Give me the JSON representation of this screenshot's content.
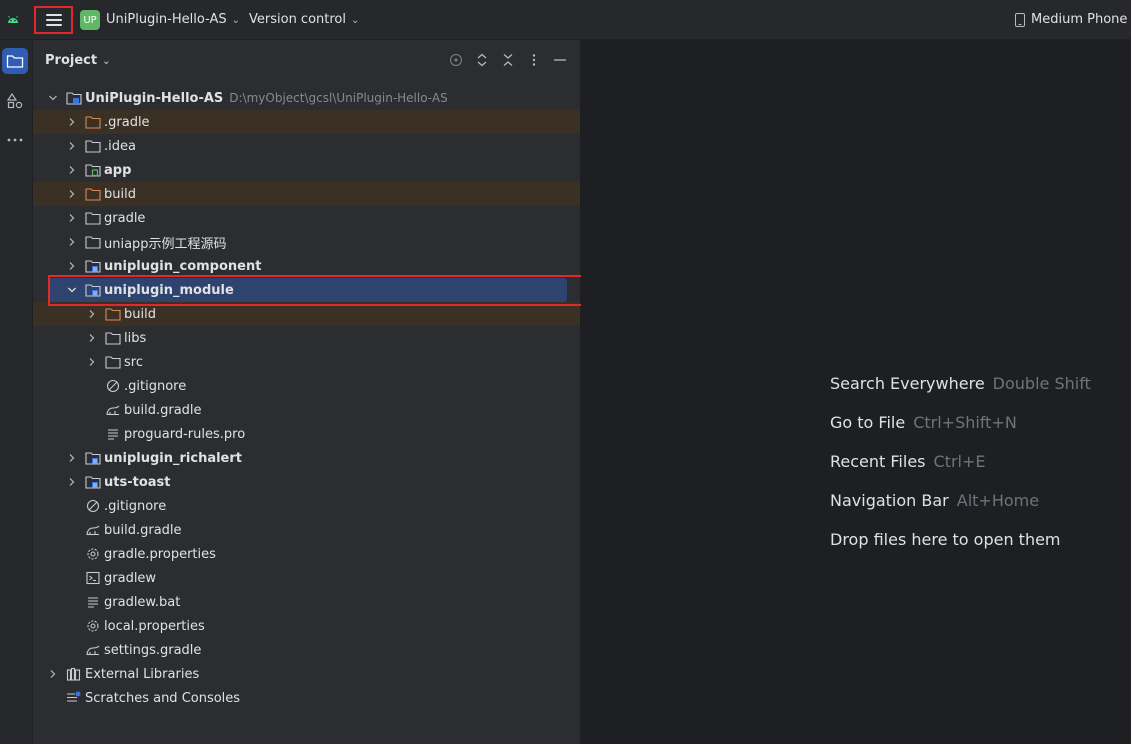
{
  "titlebar": {
    "project_badge": "UP",
    "project_name": "UniPlugin-Hello-AS",
    "vcs_label": "Version control",
    "device_label": "Medium Phone A"
  },
  "panel": {
    "title": "Project"
  },
  "tree": {
    "root": {
      "label": "UniPlugin-Hello-AS",
      "path": "D:\\myObject\\gcsl\\UniPlugin-Hello-AS"
    },
    "items": [
      {
        "label": ".gradle"
      },
      {
        "label": ".idea"
      },
      {
        "label": "app"
      },
      {
        "label": "build"
      },
      {
        "label": "gradle"
      },
      {
        "label": "uniapp示例工程源码"
      },
      {
        "label": "uniplugin_component"
      },
      {
        "label": "uniplugin_module"
      },
      {
        "label": "build"
      },
      {
        "label": "libs"
      },
      {
        "label": "src"
      },
      {
        "label": ".gitignore"
      },
      {
        "label": "build.gradle"
      },
      {
        "label": "proguard-rules.pro"
      },
      {
        "label": "uniplugin_richalert"
      },
      {
        "label": "uts-toast"
      },
      {
        "label": ".gitignore"
      },
      {
        "label": "build.gradle"
      },
      {
        "label": "gradle.properties"
      },
      {
        "label": "gradlew"
      },
      {
        "label": "gradlew.bat"
      },
      {
        "label": "local.properties"
      },
      {
        "label": "settings.gradle"
      },
      {
        "label": "External Libraries"
      },
      {
        "label": "Scratches and Consoles"
      }
    ]
  },
  "editor": {
    "hints": [
      {
        "action": "Search Everywhere",
        "key": "Double Shift"
      },
      {
        "action": "Go to File",
        "key": "Ctrl+Shift+N"
      },
      {
        "action": "Recent Files",
        "key": "Ctrl+E"
      },
      {
        "action": "Navigation Bar",
        "key": "Alt+Home"
      },
      {
        "action": "Drop files here to open them",
        "key": ""
      }
    ]
  },
  "colors": {
    "selection": "#2e436e",
    "excluded": "#3a3024",
    "highlight_outline": "#e02a2a",
    "badge": "#5fb865"
  }
}
